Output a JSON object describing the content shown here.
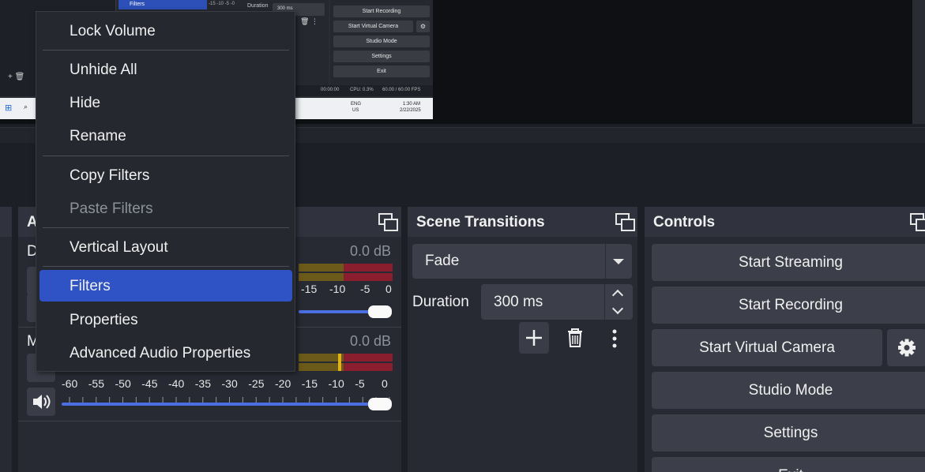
{
  "nested_preview": {
    "filters_label": "Filters",
    "meter_ticks": "-15  -10  -5  -0",
    "duration_label": "Duration",
    "duration_value": "300 ms",
    "buttons": [
      "Start Recording",
      "Start Virtual Camera",
      "Studio Mode",
      "Settings",
      "Exit"
    ],
    "status": {
      "time": "00:00:00",
      "cpu": "CPU: 0.3%",
      "fps": "60.00 / 60.00 FPS"
    },
    "taskbar": {
      "lang_top": "ENG",
      "lang_bottom": "US",
      "time": "1:30 AM",
      "date": "2/22/2025"
    }
  },
  "context_menu": {
    "items": [
      {
        "label": "Lock Volume"
      },
      {
        "label": "Unhide All"
      },
      {
        "label": "Hide"
      },
      {
        "label": "Rename"
      },
      {
        "label": "Copy Filters"
      },
      {
        "label": "Paste Filters"
      },
      {
        "label": "Vertical Layout"
      },
      {
        "label": "Filters"
      },
      {
        "label": "Properties"
      },
      {
        "label": "Advanced Audio Properties"
      }
    ]
  },
  "mixer": {
    "title_partial": "A",
    "channels": [
      {
        "name_partial": "D",
        "db": "0.0 dB"
      },
      {
        "name_partial": "M",
        "db": "0.0 dB"
      }
    ],
    "scale_full": [
      "-60",
      "-55",
      "-50",
      "-45",
      "-40",
      "-35",
      "-30",
      "-25",
      "-20",
      "-15",
      "-10",
      "-5",
      "0"
    ],
    "scale_partial": [
      "-15",
      "-10",
      "-5",
      "0"
    ]
  },
  "transitions": {
    "title": "Scene Transitions",
    "selected": "Fade",
    "duration_label": "Duration",
    "duration_value": "300 ms"
  },
  "controls": {
    "title": "Controls",
    "start_streaming": "Start Streaming",
    "start_recording": "Start Recording",
    "start_virtual_camera": "Start Virtual Camera",
    "studio_mode": "Studio Mode",
    "settings": "Settings",
    "exit": "Exit"
  },
  "colors": {
    "accent": "#2f52c4",
    "meter_green": "#6b5a1a",
    "meter_red": "#8a1e2e",
    "slider": "#4a6fe0"
  }
}
